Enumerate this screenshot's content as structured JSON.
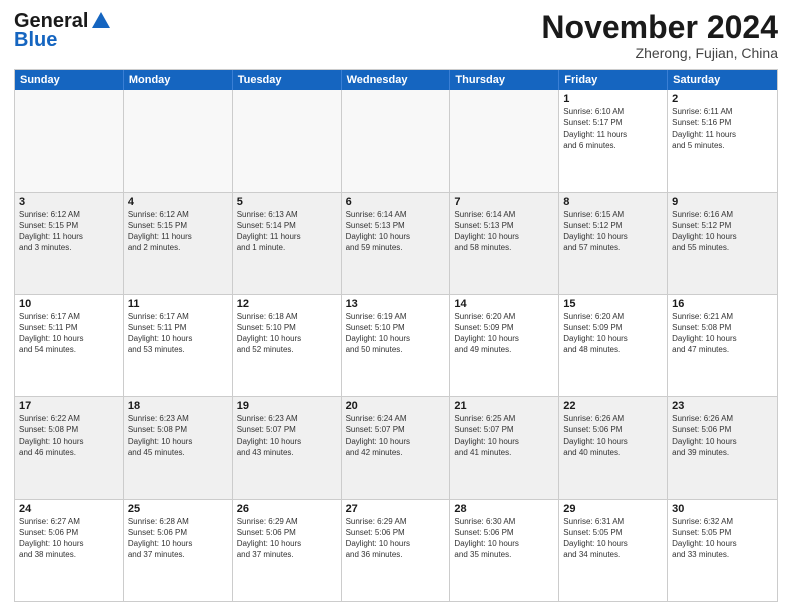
{
  "logo": {
    "line1": "General",
    "line2": "Blue"
  },
  "title": "November 2024",
  "location": "Zherong, Fujian, China",
  "headers": [
    "Sunday",
    "Monday",
    "Tuesday",
    "Wednesday",
    "Thursday",
    "Friday",
    "Saturday"
  ],
  "rows": [
    [
      {
        "day": "",
        "info": ""
      },
      {
        "day": "",
        "info": ""
      },
      {
        "day": "",
        "info": ""
      },
      {
        "day": "",
        "info": ""
      },
      {
        "day": "",
        "info": ""
      },
      {
        "day": "1",
        "info": "Sunrise: 6:10 AM\nSunset: 5:17 PM\nDaylight: 11 hours\nand 6 minutes."
      },
      {
        "day": "2",
        "info": "Sunrise: 6:11 AM\nSunset: 5:16 PM\nDaylight: 11 hours\nand 5 minutes."
      }
    ],
    [
      {
        "day": "3",
        "info": "Sunrise: 6:12 AM\nSunset: 5:15 PM\nDaylight: 11 hours\nand 3 minutes."
      },
      {
        "day": "4",
        "info": "Sunrise: 6:12 AM\nSunset: 5:15 PM\nDaylight: 11 hours\nand 2 minutes."
      },
      {
        "day": "5",
        "info": "Sunrise: 6:13 AM\nSunset: 5:14 PM\nDaylight: 11 hours\nand 1 minute."
      },
      {
        "day": "6",
        "info": "Sunrise: 6:14 AM\nSunset: 5:13 PM\nDaylight: 10 hours\nand 59 minutes."
      },
      {
        "day": "7",
        "info": "Sunrise: 6:14 AM\nSunset: 5:13 PM\nDaylight: 10 hours\nand 58 minutes."
      },
      {
        "day": "8",
        "info": "Sunrise: 6:15 AM\nSunset: 5:12 PM\nDaylight: 10 hours\nand 57 minutes."
      },
      {
        "day": "9",
        "info": "Sunrise: 6:16 AM\nSunset: 5:12 PM\nDaylight: 10 hours\nand 55 minutes."
      }
    ],
    [
      {
        "day": "10",
        "info": "Sunrise: 6:17 AM\nSunset: 5:11 PM\nDaylight: 10 hours\nand 54 minutes."
      },
      {
        "day": "11",
        "info": "Sunrise: 6:17 AM\nSunset: 5:11 PM\nDaylight: 10 hours\nand 53 minutes."
      },
      {
        "day": "12",
        "info": "Sunrise: 6:18 AM\nSunset: 5:10 PM\nDaylight: 10 hours\nand 52 minutes."
      },
      {
        "day": "13",
        "info": "Sunrise: 6:19 AM\nSunset: 5:10 PM\nDaylight: 10 hours\nand 50 minutes."
      },
      {
        "day": "14",
        "info": "Sunrise: 6:20 AM\nSunset: 5:09 PM\nDaylight: 10 hours\nand 49 minutes."
      },
      {
        "day": "15",
        "info": "Sunrise: 6:20 AM\nSunset: 5:09 PM\nDaylight: 10 hours\nand 48 minutes."
      },
      {
        "day": "16",
        "info": "Sunrise: 6:21 AM\nSunset: 5:08 PM\nDaylight: 10 hours\nand 47 minutes."
      }
    ],
    [
      {
        "day": "17",
        "info": "Sunrise: 6:22 AM\nSunset: 5:08 PM\nDaylight: 10 hours\nand 46 minutes."
      },
      {
        "day": "18",
        "info": "Sunrise: 6:23 AM\nSunset: 5:08 PM\nDaylight: 10 hours\nand 45 minutes."
      },
      {
        "day": "19",
        "info": "Sunrise: 6:23 AM\nSunset: 5:07 PM\nDaylight: 10 hours\nand 43 minutes."
      },
      {
        "day": "20",
        "info": "Sunrise: 6:24 AM\nSunset: 5:07 PM\nDaylight: 10 hours\nand 42 minutes."
      },
      {
        "day": "21",
        "info": "Sunrise: 6:25 AM\nSunset: 5:07 PM\nDaylight: 10 hours\nand 41 minutes."
      },
      {
        "day": "22",
        "info": "Sunrise: 6:26 AM\nSunset: 5:06 PM\nDaylight: 10 hours\nand 40 minutes."
      },
      {
        "day": "23",
        "info": "Sunrise: 6:26 AM\nSunset: 5:06 PM\nDaylight: 10 hours\nand 39 minutes."
      }
    ],
    [
      {
        "day": "24",
        "info": "Sunrise: 6:27 AM\nSunset: 5:06 PM\nDaylight: 10 hours\nand 38 minutes."
      },
      {
        "day": "25",
        "info": "Sunrise: 6:28 AM\nSunset: 5:06 PM\nDaylight: 10 hours\nand 37 minutes."
      },
      {
        "day": "26",
        "info": "Sunrise: 6:29 AM\nSunset: 5:06 PM\nDaylight: 10 hours\nand 37 minutes."
      },
      {
        "day": "27",
        "info": "Sunrise: 6:29 AM\nSunset: 5:06 PM\nDaylight: 10 hours\nand 36 minutes."
      },
      {
        "day": "28",
        "info": "Sunrise: 6:30 AM\nSunset: 5:06 PM\nDaylight: 10 hours\nand 35 minutes."
      },
      {
        "day": "29",
        "info": "Sunrise: 6:31 AM\nSunset: 5:05 PM\nDaylight: 10 hours\nand 34 minutes."
      },
      {
        "day": "30",
        "info": "Sunrise: 6:32 AM\nSunset: 5:05 PM\nDaylight: 10 hours\nand 33 minutes."
      }
    ]
  ]
}
